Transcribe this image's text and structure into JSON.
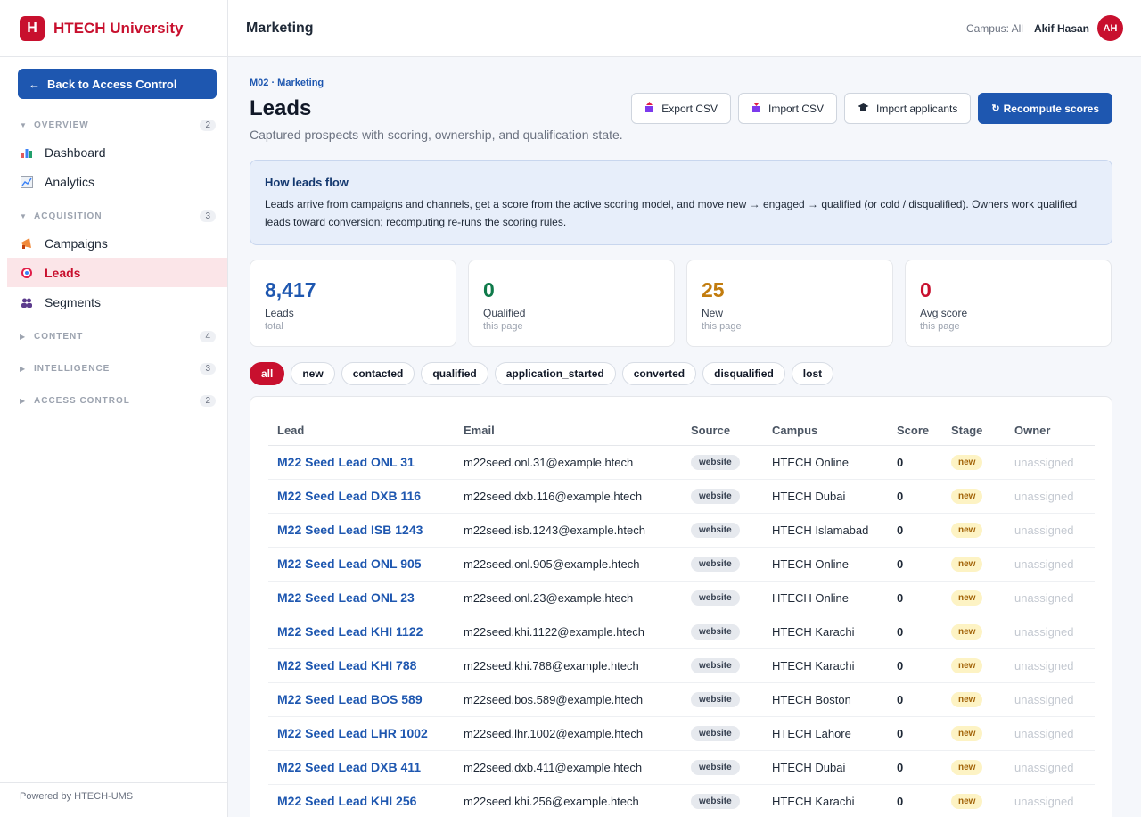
{
  "brand": {
    "logo": "H",
    "name": "HTECH University"
  },
  "sidebar": {
    "back_label": "Back to Access Control",
    "sections": [
      {
        "label": "OVERVIEW",
        "count": "2",
        "expanded": true
      },
      {
        "label": "ACQUISITION",
        "count": "3",
        "expanded": true
      },
      {
        "label": "CONTENT",
        "count": "4",
        "expanded": false
      },
      {
        "label": "INTELLIGENCE",
        "count": "3",
        "expanded": false
      },
      {
        "label": "ACCESS CONTROL",
        "count": "2",
        "expanded": false
      }
    ],
    "items": [
      {
        "label": "Dashboard",
        "icon": "bar-chart-icon"
      },
      {
        "label": "Analytics",
        "icon": "line-chart-icon"
      },
      {
        "label": "Campaigns",
        "icon": "megaphone-icon"
      },
      {
        "label": "Leads",
        "icon": "target-icon",
        "active": true
      },
      {
        "label": "Segments",
        "icon": "people-icon"
      }
    ],
    "footer": "Powered by HTECH-UMS"
  },
  "topbar": {
    "title": "Marketing",
    "campus": "Campus: All",
    "user": "Akif Hasan",
    "initials": "AH"
  },
  "page": {
    "crumb": "M02 · Marketing",
    "title": "Leads",
    "subtitle": "Captured prospects with scoring, ownership, and qualification state.",
    "actions": {
      "export": "Export CSV",
      "import": "Import CSV",
      "import_applicants": "Import applicants",
      "recompute": "Recompute scores"
    }
  },
  "info": {
    "title": "How leads flow",
    "text": "Leads arrive from campaigns and channels, get a score from the active scoring model, and move new → engaged → qualified (or cold / disqualified). Owners work qualified leads toward conversion; recomputing re-runs the scoring rules."
  },
  "stats": [
    {
      "value": "8,417",
      "label": "Leads",
      "sub": "total",
      "color": "#1e57b0"
    },
    {
      "value": "0",
      "label": "Qualified",
      "sub": "this page",
      "color": "#0f7a4a"
    },
    {
      "value": "25",
      "label": "New",
      "sub": "this page",
      "color": "#c27c0e"
    },
    {
      "value": "0",
      "label": "Avg score",
      "sub": "this page",
      "color": "#c8102e"
    }
  ],
  "filters": [
    "all",
    "new",
    "contacted",
    "qualified",
    "application_started",
    "converted",
    "disqualified",
    "lost"
  ],
  "active_filter": "all",
  "table": {
    "headers": [
      "Lead",
      "Email",
      "Source",
      "Campus",
      "Score",
      "Stage",
      "Owner"
    ],
    "rows": [
      [
        "M22 Seed Lead ONL 31",
        "m22seed.onl.31@example.htech",
        "website",
        "HTECH Online",
        "0",
        "new",
        "unassigned"
      ],
      [
        "M22 Seed Lead DXB 116",
        "m22seed.dxb.116@example.htech",
        "website",
        "HTECH Dubai",
        "0",
        "new",
        "unassigned"
      ],
      [
        "M22 Seed Lead ISB 1243",
        "m22seed.isb.1243@example.htech",
        "website",
        "HTECH Islamabad",
        "0",
        "new",
        "unassigned"
      ],
      [
        "M22 Seed Lead ONL 905",
        "m22seed.onl.905@example.htech",
        "website",
        "HTECH Online",
        "0",
        "new",
        "unassigned"
      ],
      [
        "M22 Seed Lead ONL 23",
        "m22seed.onl.23@example.htech",
        "website",
        "HTECH Online",
        "0",
        "new",
        "unassigned"
      ],
      [
        "M22 Seed Lead KHI 1122",
        "m22seed.khi.1122@example.htech",
        "website",
        "HTECH Karachi",
        "0",
        "new",
        "unassigned"
      ],
      [
        "M22 Seed Lead KHI 788",
        "m22seed.khi.788@example.htech",
        "website",
        "HTECH Karachi",
        "0",
        "new",
        "unassigned"
      ],
      [
        "M22 Seed Lead BOS 589",
        "m22seed.bos.589@example.htech",
        "website",
        "HTECH Boston",
        "0",
        "new",
        "unassigned"
      ],
      [
        "M22 Seed Lead LHR 1002",
        "m22seed.lhr.1002@example.htech",
        "website",
        "HTECH Lahore",
        "0",
        "new",
        "unassigned"
      ],
      [
        "M22 Seed Lead DXB 411",
        "m22seed.dxb.411@example.htech",
        "website",
        "HTECH Dubai",
        "0",
        "new",
        "unassigned"
      ],
      [
        "M22 Seed Lead KHI 256",
        "m22seed.khi.256@example.htech",
        "website",
        "HTECH Karachi",
        "0",
        "new",
        "unassigned"
      ]
    ]
  }
}
